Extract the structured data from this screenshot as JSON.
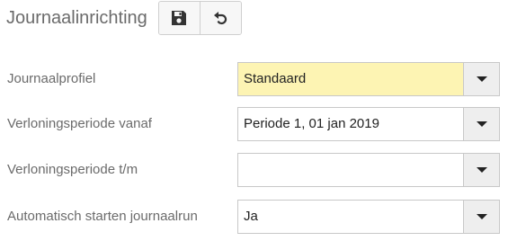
{
  "header": {
    "title": "Journaalinrichting",
    "buttons": [
      {
        "name": "save",
        "icon": "floppy-disk-icon"
      },
      {
        "name": "undo",
        "icon": "undo-arrow-icon"
      }
    ]
  },
  "form": {
    "fields": [
      {
        "label": "Journaalprofiel",
        "value": "Standaard",
        "highlighted": true,
        "highlight_color": "#fdf4b3"
      },
      {
        "label": "Verloningsperiode vanaf",
        "value": "Periode 1, 01 jan 2019",
        "highlighted": false
      },
      {
        "label": "Verloningsperiode t/m",
        "value": "",
        "highlighted": false
      },
      {
        "label": "Automatisch starten journaalrun",
        "value": "Ja",
        "highlighted": false
      }
    ]
  }
}
